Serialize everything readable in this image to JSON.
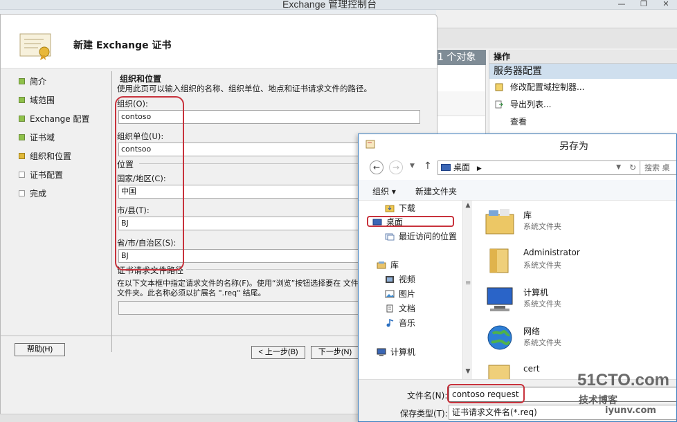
{
  "console": {
    "title": "Exchange 管理控制台",
    "object_count": "1 个对象",
    "actions_header": "操作",
    "actions_section": "服务器配置",
    "actions": [
      "修改配置域控制器...",
      "导出列表...",
      "查看"
    ]
  },
  "wizard": {
    "title": "新建 Exchange 证书",
    "steps": [
      {
        "label": "简介",
        "state": "done"
      },
      {
        "label": "域范围",
        "state": "done"
      },
      {
        "label": "Exchange 配置",
        "state": "done"
      },
      {
        "label": "证书域",
        "state": "done"
      },
      {
        "label": "组织和位置",
        "state": "current"
      },
      {
        "label": "证书配置",
        "state": "todo"
      },
      {
        "label": "完成",
        "state": "todo"
      }
    ],
    "section_title": "组织和位置",
    "section_desc": "使用此页可以输入组织的名称、组织单位、地点和证书请求文件的路径。",
    "org_label": "组织(O):",
    "org_value": "contoso",
    "ou_label": "组织单位(U):",
    "ou_value": "contsoo",
    "location_group": "位置",
    "country_label": "国家/地区(C):",
    "country_value": "中国",
    "city_label": "市/县(T):",
    "city_value": "BJ",
    "state_label": "省/市/自治区(S):",
    "state_value": "BJ",
    "req_group": "证书请求文件路径",
    "req_desc": "在以下文本框中指定请求文件的名称(F)。使用“浏览”按钮选择要在 文件的文件夹。此名称必须以扩展名 \".req\" 结尾。",
    "help_button": "帮助(H)",
    "back_button": "< 上一步(B)",
    "next_button": "下一步(N)"
  },
  "saveas": {
    "title": "另存为",
    "address": "桌面",
    "search_placeholder": "搜索 桌",
    "organize": "组织 ▾",
    "new_folder": "新建文件夹",
    "nav": {
      "downloads": "下载",
      "desktop": "桌面",
      "recent": "最近访问的位置",
      "libraries": "库",
      "videos": "视频",
      "pictures": "图片",
      "documents": "文档",
      "music": "音乐",
      "computer": "计算机"
    },
    "files": [
      {
        "name": "库",
        "desc": "系统文件夹"
      },
      {
        "name": "Administrator",
        "desc": "系统文件夹"
      },
      {
        "name": "计算机",
        "desc": "系统文件夹"
      },
      {
        "name": "网络",
        "desc": "系统文件夹"
      },
      {
        "name": "cert",
        "desc": ""
      }
    ],
    "filename_label": "文件名(N):",
    "filename_value": "contoso request",
    "filetype_label": "保存类型(T):",
    "filetype_value": "证书请求文件名(*.req)"
  },
  "watermark": {
    "line1": "51CTO.com",
    "line2": "技术博客",
    "line3": "iyunv.com"
  },
  "colors": {
    "accent_red": "#c8323c",
    "selection_blue": "#cfdfee"
  }
}
